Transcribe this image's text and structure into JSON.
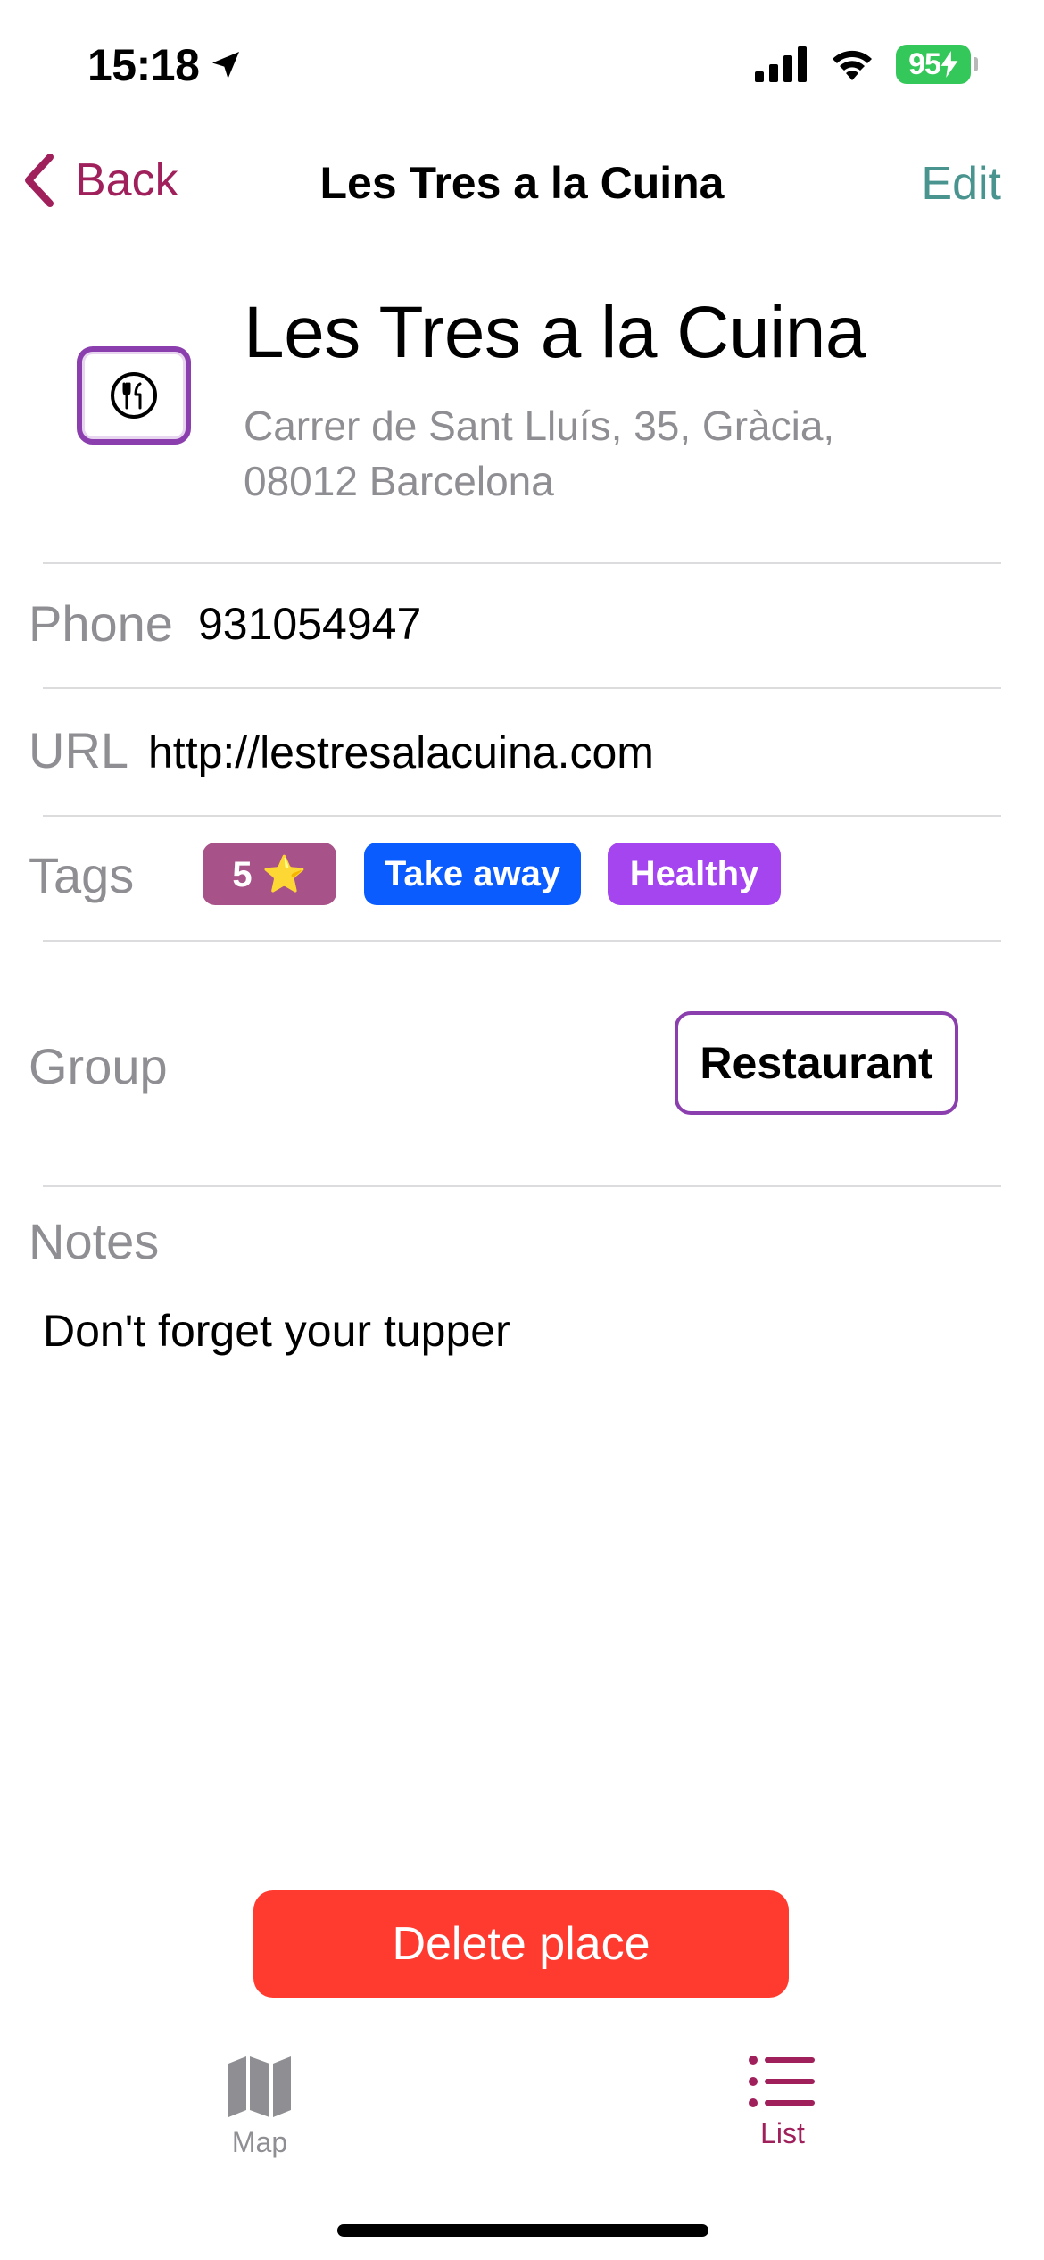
{
  "status_bar": {
    "time": "15:18",
    "battery": "95"
  },
  "nav": {
    "back_label": "Back",
    "title": "Les Tres a la Cuina",
    "edit_label": "Edit"
  },
  "place": {
    "name": "Les Tres a la Cuina",
    "address_line1": "Carrer de Sant Lluís, 35, Gràcia,",
    "address_line2": "08012 Barcelona",
    "icon": "fork-knife-icon"
  },
  "fields": {
    "phone_label": "Phone",
    "phone_value": "931054947",
    "url_label": "URL",
    "url_value": "http://lestresalacuina.com",
    "tags_label": "Tags",
    "tags": [
      {
        "label": "5 ⭐️",
        "color": "#a8528a"
      },
      {
        "label": "Take away",
        "color": "#0a5cff"
      },
      {
        "label": "Healthy",
        "color": "#a445f0"
      }
    ],
    "group_label": "Group",
    "group_value": "Restaurant",
    "notes_label": "Notes",
    "notes_value": "Don't forget your tupper"
  },
  "actions": {
    "delete_label": "Delete place"
  },
  "tab_bar": {
    "tabs": [
      {
        "label": "Map",
        "icon": "map-icon",
        "active": false
      },
      {
        "label": "List",
        "icon": "list-icon",
        "active": true
      }
    ]
  },
  "colors": {
    "accent": "#a0205c",
    "edit": "#4a9490",
    "group_border": "#8b3fae",
    "delete": "#ff3b30",
    "inactive_tab": "#8e8e93"
  }
}
